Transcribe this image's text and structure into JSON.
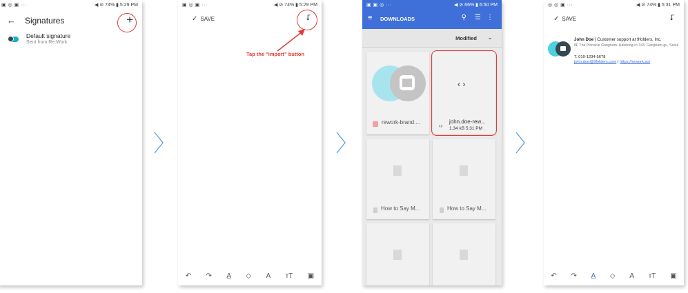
{
  "phone1": {
    "status_left": "▣ ◎ ▣ ···",
    "status_right": "◀ ⊘ 74% ▮ 5:29 PM",
    "title": "Signatures",
    "back_icon": "arrow-left-icon",
    "add_icon": "plus-icon",
    "item_title": "Default signature",
    "item_sub": "Sent from Re:Work"
  },
  "phone2": {
    "status_left": "▣ ◎ ▣ ···",
    "status_right": "◀ ⊘ 74% ▮ 5:29 PM",
    "save_label": "SAVE",
    "annotation": "Tap the \"import\" button",
    "accent": "#e53935"
  },
  "phone3": {
    "status_left": "▣ ▣ ◎ ···",
    "status_right": "◀ ⊘ 66% ▮ 6:50 PM",
    "title": "DOWNLOADS",
    "sort_label": "Modified",
    "appbar_color": "#3f6fd8",
    "files": [
      {
        "name": "rework-brand...."
      },
      {
        "name": "john.doe-rew...",
        "meta": "1.34 kB  5:31 PM"
      },
      {
        "name": "How to Say M..."
      },
      {
        "name": "How to Say M..."
      }
    ]
  },
  "phone4": {
    "status_left": "◎ ◎ ▣ ···",
    "status_right": "◀ ⊘ 74% ▮ 5:31 PM",
    "save_label": "SAVE",
    "name": "John Doe",
    "role": " | Customer support at 9folders, Inc.",
    "address": "8F The Pinnacle Gangnam, Hakdong-ro 343, Gangnam-gu, Seoul",
    "phone": "T. 010-1234-5678",
    "email": "john.doe@9folders.com",
    "sep": " | ",
    "url": "https://rework.so/",
    "logo_colors": [
      "#4dd0e1",
      "#37474f"
    ]
  },
  "editor_tools": [
    "↶",
    "↷",
    "A̲",
    "◇",
    "A",
    "ᴛT",
    "▣"
  ]
}
